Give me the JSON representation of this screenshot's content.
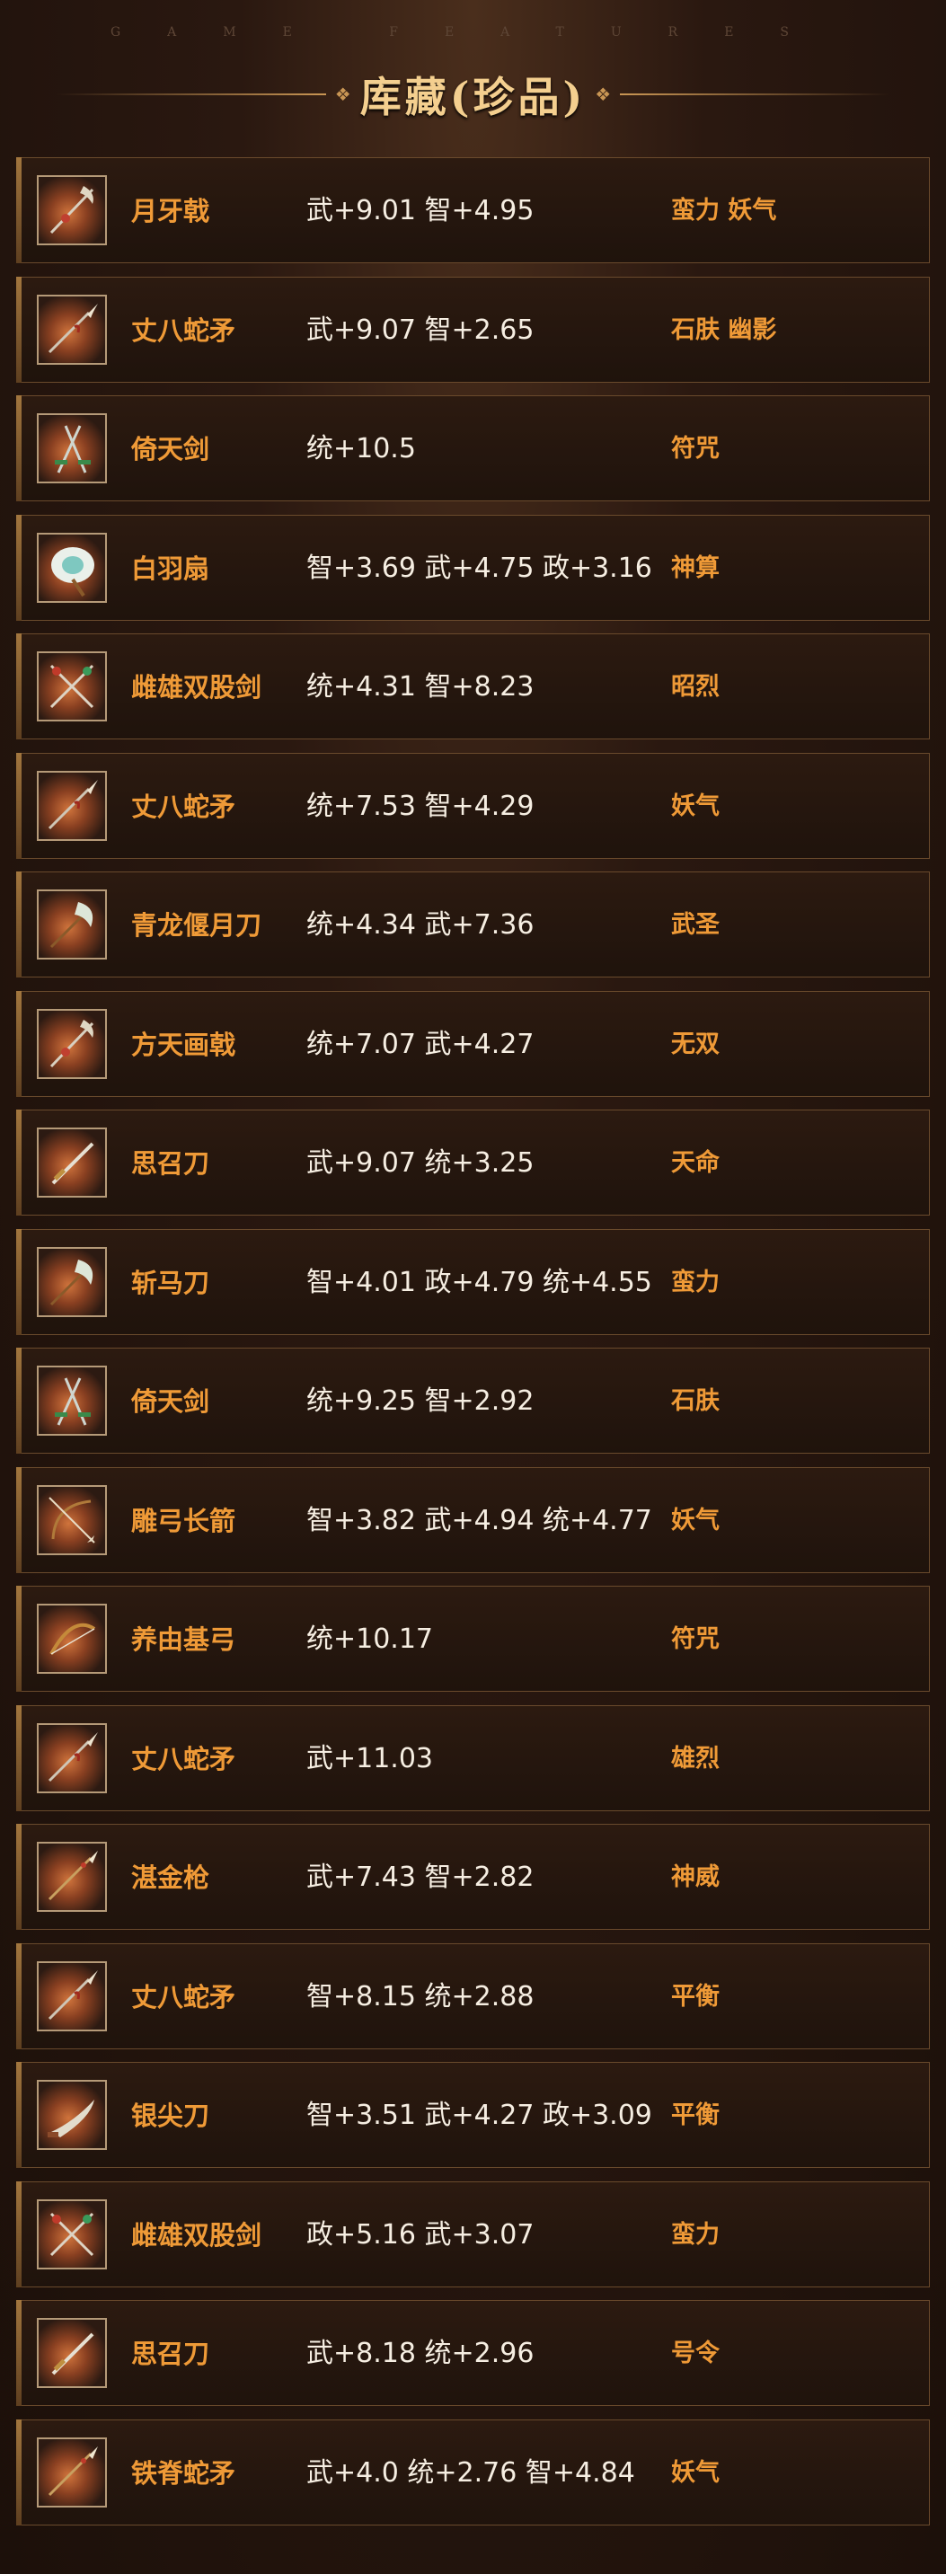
{
  "header": {
    "ghost_text": "GAME FEATURES",
    "title": "库藏(珍品)"
  },
  "items": [
    {
      "icon": "halberd-icon",
      "name": "月牙戟",
      "stats": "武+9.01 智+4.95",
      "skills": "蛮力 妖气"
    },
    {
      "icon": "serpent-spear-icon",
      "name": "丈八蛇矛",
      "stats": "武+9.07 智+2.65",
      "skills": "石肤 幽影"
    },
    {
      "icon": "twin-sword-icon",
      "name": "倚天剑",
      "stats": "统+10.5",
      "skills": "符咒"
    },
    {
      "icon": "feather-fan-icon",
      "name": "白羽扇",
      "stats": "智+3.69 武+4.75 政+3.16",
      "skills": "神算"
    },
    {
      "icon": "crossed-swords-icon",
      "name": "雌雄双股剑",
      "stats": "统+4.31 智+8.23",
      "skills": "昭烈"
    },
    {
      "icon": "serpent-spear-icon",
      "name": "丈八蛇矛",
      "stats": "统+7.53 智+4.29",
      "skills": "妖气"
    },
    {
      "icon": "glaive-icon",
      "name": "青龙偃月刀",
      "stats": "统+4.34 武+7.36",
      "skills": "武圣"
    },
    {
      "icon": "halberd-icon",
      "name": "方天画戟",
      "stats": "统+7.07 武+4.27",
      "skills": "无双"
    },
    {
      "icon": "sword-icon",
      "name": "思召刀",
      "stats": "武+9.07 统+3.25",
      "skills": "天命"
    },
    {
      "icon": "glaive-icon",
      "name": "斩马刀",
      "stats": "智+4.01 政+4.79 统+4.55",
      "skills": "蛮力"
    },
    {
      "icon": "twin-sword-icon",
      "name": "倚天剑",
      "stats": "统+9.25 智+2.92",
      "skills": "石肤"
    },
    {
      "icon": "bow-arrow-icon",
      "name": "雕弓长箭",
      "stats": "智+3.82 武+4.94 统+4.77",
      "skills": "妖气"
    },
    {
      "icon": "bow-icon",
      "name": "养由基弓",
      "stats": "统+10.17",
      "skills": "符咒"
    },
    {
      "icon": "serpent-spear-icon",
      "name": "丈八蛇矛",
      "stats": "武+11.03",
      "skills": "雄烈"
    },
    {
      "icon": "spear-icon",
      "name": "湛金枪",
      "stats": "武+7.43 智+2.82",
      "skills": "神威"
    },
    {
      "icon": "serpent-spear-icon",
      "name": "丈八蛇矛",
      "stats": "智+8.15 统+2.88",
      "skills": "平衡"
    },
    {
      "icon": "blade-icon",
      "name": "银尖刀",
      "stats": "智+3.51 武+4.27 政+3.09",
      "skills": "平衡"
    },
    {
      "icon": "crossed-swords-icon",
      "name": "雌雄双股剑",
      "stats": "政+5.16 武+3.07",
      "skills": "蛮力"
    },
    {
      "icon": "sword-icon",
      "name": "思召刀",
      "stats": "武+8.18 统+2.96",
      "skills": "号令"
    },
    {
      "icon": "spear-icon",
      "name": "铁脊蛇矛",
      "stats": "武+4.0 统+2.76 智+4.84",
      "skills": "妖气"
    }
  ],
  "colors": {
    "accent_orange": "#ef9a37",
    "title_gold": "#f4cf8f",
    "border_brown": "#6a4a2c"
  }
}
